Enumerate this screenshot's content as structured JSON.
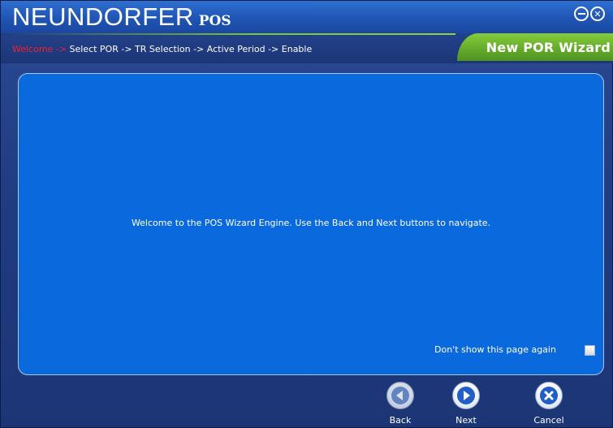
{
  "app": {
    "brand": "NEUNDORFER",
    "brand_sub": "POS"
  },
  "window_controls": {
    "minimize_icon": "minimize-circle-icon",
    "close_icon": "close-circle-icon"
  },
  "breadcrumb": {
    "current": "Welcome ->",
    "rest": " Select POR -> TR Selection -> Active Period -> Enable"
  },
  "wizard": {
    "title": "New POR Wizard"
  },
  "panel": {
    "welcome_text": "Welcome to the POS Wizard Engine. Use the Back and Next buttons to navigate.",
    "dont_show_label": "Don't show this page again",
    "dont_show_checked": false
  },
  "nav": {
    "back_label": "Back",
    "next_label": "Next",
    "cancel_label": "Cancel",
    "back_icon": "arrow-left-circle-icon",
    "next_icon": "arrow-right-circle-icon",
    "cancel_icon": "x-circle-icon"
  },
  "colors": {
    "accent_green": "#7bc23a",
    "panel_blue": "#0a69dc",
    "current_step_red": "#ee2233",
    "icon_blue": "#1f5fc7"
  }
}
